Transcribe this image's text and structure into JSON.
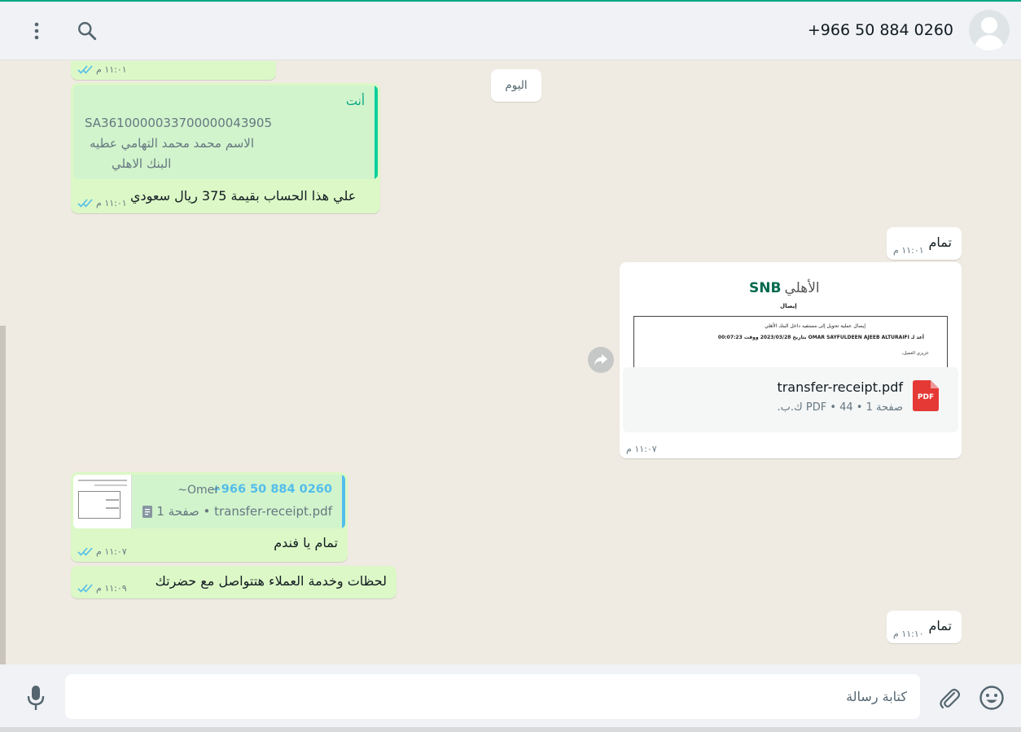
{
  "header": {
    "contact_name": "+966 50 884 0260",
    "menu_icon": "more-vertical-icon",
    "search_icon": "search-icon",
    "avatar_icon": "default-avatar-icon"
  },
  "chat": {
    "date_chip": "اليوم",
    "messages": [
      {
        "time": "١١:٠١ م"
      },
      {
        "quote_author": "أنت",
        "quote_lines": [
          "SA3610000033700000043905",
          "الاسم محمد محمد التهامي عطيه",
          "البنك الاهلي"
        ],
        "text": "علي هذا الحساب بقيمة 375 ريال سعودي",
        "time": "١١:٠١ م"
      },
      {
        "text": "تمام",
        "time": "١١:٠١ م"
      },
      {
        "preview_logo_ar": "الأهلي",
        "preview_logo_en": "SNB",
        "preview_heading": "إيصال",
        "preview_line1": "إيصال عملية تحويل إلى مستفيد داخل البنك الأهلي",
        "preview_line2": "أعد لـ OMAR SAYFULDEEN AJEEB ALTURAIFI بتاريخ 2023/03/28 ووقت 00:07:23",
        "preview_line3": "عزيزي العميل،",
        "file_name": "transfer-receipt.pdf",
        "file_meta": "صفحة 1 • PDF • 44 ك.ب.",
        "pdf_badge": "PDF",
        "time": "١١:٠٧ م"
      },
      {
        "quote_author": "+966 50 884 0260",
        "quote_alias": "~Omer",
        "quote_file": "transfer-receipt.pdf • صفحة 1",
        "text": "تمام يا فندم",
        "time": "١١:٠٧ م"
      },
      {
        "text": "لحظات وخدمة العملاء هتتواصل مع حضرتك",
        "time": "١١:٠٩ م"
      },
      {
        "text": "تمام",
        "time": "١١:١٠ م"
      }
    ]
  },
  "composer": {
    "placeholder": "كتابة رسالة",
    "emoji_icon": "emoji-icon",
    "attach_icon": "paperclip-icon",
    "mic_icon": "microphone-icon"
  },
  "colors": {
    "accent": "#00a884",
    "incoming_bubble": "#dcf8c6",
    "outgoing_bubble": "#ffffff",
    "read_ticks": "#53bdeb",
    "pdf_red": "#e53935"
  }
}
